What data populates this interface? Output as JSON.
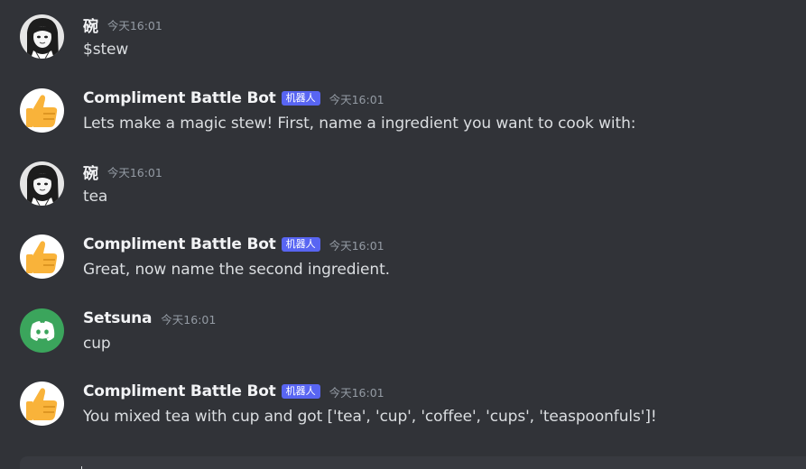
{
  "messages": [
    {
      "author": "碗",
      "avatar_icon": "anime-girl-avatar",
      "is_bot": false,
      "bot_tag": "",
      "timestamp": "今天16:01",
      "content": "$stew"
    },
    {
      "author": "Compliment Battle Bot",
      "avatar_icon": "thumbs-up-avatar",
      "is_bot": true,
      "bot_tag": "机器人",
      "timestamp": "今天16:01",
      "content": "Lets make a magic stew! First, name a ingredient you want to cook with:"
    },
    {
      "author": "碗",
      "avatar_icon": "anime-girl-avatar",
      "is_bot": false,
      "bot_tag": "",
      "timestamp": "今天16:01",
      "content": "tea"
    },
    {
      "author": "Compliment Battle Bot",
      "avatar_icon": "thumbs-up-avatar",
      "is_bot": true,
      "bot_tag": "机器人",
      "timestamp": "今天16:01",
      "content": "Great, now name the second ingredient."
    },
    {
      "author": "Setsuna",
      "avatar_icon": "discord-logo-avatar",
      "is_bot": false,
      "bot_tag": "",
      "timestamp": "今天16:01",
      "content": "cup"
    },
    {
      "author": "Compliment Battle Bot",
      "avatar_icon": "thumbs-up-avatar",
      "is_bot": true,
      "bot_tag": "机器人",
      "timestamp": "今天16:01",
      "content": "You mixed tea with cup and got ['tea', 'cup', 'coffee', 'cups', 'teaspoonfuls']!"
    }
  ],
  "colors": {
    "background": "#313338",
    "bot_tag": "#5865f2",
    "discord_green": "#3ba55c",
    "thumbs_yellow": "#f9b33a"
  }
}
